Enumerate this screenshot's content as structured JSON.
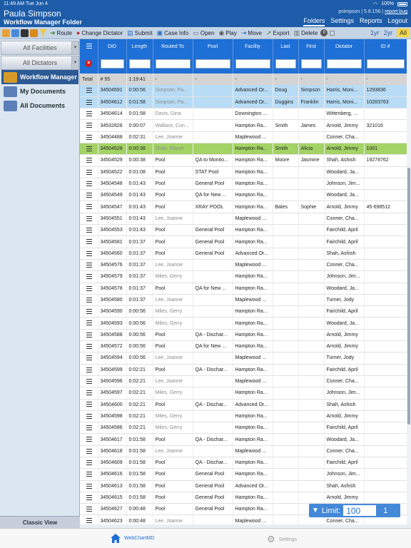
{
  "status": {
    "time": "11:49 AM",
    "date": "Tue Jun 4",
    "battery": "100%"
  },
  "header": {
    "user": "Paula Simpson",
    "folder": "Workflow Manager Folder",
    "account": "psimpson | 5.8.156 |",
    "report_bug": "report bug",
    "nav": [
      "Folders",
      "Settings",
      "Reports",
      "Logout"
    ]
  },
  "toolbar": {
    "route": "Route",
    "change_dictator": "Change Dictator",
    "submit": "Submit",
    "case_info": "Case Info",
    "open": "Open",
    "play": "Play",
    "move": "Move",
    "export": "Export",
    "delete": "Delete",
    "delete_count": "0",
    "range": [
      "1yr",
      "2yr",
      "All"
    ]
  },
  "sidebar": {
    "facilities": "All Facilities",
    "dictators": "All Dictators",
    "items": [
      "Workflow Manager",
      "My Documents",
      "All Documents"
    ],
    "classic": "Classic View"
  },
  "table": {
    "columns": [
      "DID",
      "Length",
      "Routed To",
      "Pool",
      "Facility",
      "Last",
      "First",
      "Dictator",
      "ID #"
    ],
    "total": {
      "label": "Total",
      "did": "# 55",
      "length": "1:19:41",
      "dash": "-"
    },
    "rows": [
      [
        "34504591",
        "0:00:56",
        "Simpson, Pa...",
        "",
        "Advanced Or...",
        "Doug",
        "Simpson",
        "Harris, Moni...",
        "1293836"
      ],
      [
        "34504612",
        "0:01:58",
        "Simpson, Pa...",
        "",
        "Advanced Or...",
        "Duggins",
        "Franklin",
        "Harris, Moni...",
        "10283763"
      ],
      [
        "34504614",
        "0:01:58",
        "Davis, Gina",
        "",
        "Downington ...",
        "",
        "",
        "Wittenberg, ...",
        ""
      ],
      [
        "34532828",
        "0:00:07",
        "Wallace, Con...",
        "",
        "Hampton Ra...",
        "Smith",
        "James",
        "Arnold, Jimmy",
        "321016"
      ],
      [
        "34504488",
        "0:02:31",
        "Lee, Joanne",
        "",
        "Maplewood ...",
        "",
        "",
        "Conner, Cha...",
        ""
      ],
      [
        "34504528",
        "0:00:38",
        "Shah, Ritesh",
        "",
        "Hampton Ra...",
        "Smith",
        "Alicia",
        "Arnold, Jimmy",
        "1001"
      ],
      [
        "34504529",
        "0:00:38",
        "Pool",
        "QA to Monito...",
        "Hampton Ra...",
        "Moore",
        "Jasmine",
        "Shah, Ashish",
        "19278762"
      ],
      [
        "34504522",
        "0:01:08",
        "Pool",
        "STAT Pool",
        "Hampton Ra...",
        "",
        "",
        "Woodard, Ja...",
        ""
      ],
      [
        "34504548",
        "0:01:43",
        "Pool",
        "General Pool",
        "Hampton Ra...",
        "",
        "",
        "Johnson, Jim...",
        ""
      ],
      [
        "34504549",
        "0:01:43",
        "Pool",
        "QA for New ...",
        "Hampton Ra...",
        "",
        "",
        "Woodard, Ja...",
        ""
      ],
      [
        "34504547",
        "0:01:43",
        "Pool",
        "XRAY POOL",
        "Hampton Ra...",
        "Bales",
        "Sophie",
        "Arnold, Jimmy",
        "45-698512"
      ],
      [
        "34504551",
        "0:01:43",
        "Lee, Joanne",
        "",
        "Maplewood ...",
        "",
        "",
        "Conner, Cha...",
        ""
      ],
      [
        "34504553",
        "0:01:43",
        "Pool",
        "General Pool",
        "Hampton Ra...",
        "",
        "",
        "Fairchild, April",
        ""
      ],
      [
        "34504581",
        "0:01:37",
        "Pool",
        "General Pool",
        "Hampton Ra...",
        "",
        "",
        "Fairchild, April",
        ""
      ],
      [
        "34504560",
        "0:01:37",
        "Pool",
        "General Pool",
        "Advanced Or...",
        "",
        "",
        "Shah, Ashish",
        ""
      ],
      [
        "34504576",
        "0:01:37",
        "Lee, Joanne",
        "",
        "Maplewood ...",
        "",
        "",
        "Conner, Cha...",
        ""
      ],
      [
        "34504579",
        "0:01:37",
        "Miles, Gerry",
        "",
        "Hampton Ra...",
        "",
        "",
        "Johnson, Jim...",
        ""
      ],
      [
        "34504578",
        "0:01:37",
        "Pool",
        "QA for New ...",
        "Hampton Ra...",
        "",
        "",
        "Woodard, Ja...",
        ""
      ],
      [
        "34504580",
        "0:01:37",
        "Lee, Joanne",
        "",
        "Maplewood ...",
        "",
        "",
        "Turner, Jody",
        ""
      ],
      [
        "34504590",
        "0:00:56",
        "Miles, Gerry",
        "",
        "Hampton Ra...",
        "",
        "",
        "Fairchild, April",
        ""
      ],
      [
        "34504593",
        "0:00:56",
        "Miles, Gerry",
        "",
        "Hampton Ra...",
        "",
        "",
        "Woodard, Ja...",
        ""
      ],
      [
        "34504588",
        "0:00:56",
        "Pool",
        "QA - Dischar...",
        "Hampton Ra...",
        "",
        "",
        "Arnold, Jimmy",
        ""
      ],
      [
        "34504572",
        "0:00:56",
        "Pool",
        "QA for New ...",
        "Hampton Ra...",
        "",
        "",
        "Arnold, Jimmy",
        ""
      ],
      [
        "34504594",
        "0:00:56",
        "Lee, Joanne",
        "",
        "Maplewood ...",
        "",
        "",
        "Turner, Jody",
        ""
      ],
      [
        "34504599",
        "0:02:21",
        "Pool",
        "QA - Dischar...",
        "Hampton Ra...",
        "",
        "",
        "Fairchild, April",
        ""
      ],
      [
        "34504596",
        "0:02:21",
        "Lee, Joanne",
        "",
        "Maplewood ...",
        "",
        "",
        "Conner, Cha...",
        ""
      ],
      [
        "34504597",
        "0:02:21",
        "Miles, Gerry",
        "",
        "Hampton Ra...",
        "",
        "",
        "Johnson, Jim...",
        ""
      ],
      [
        "34504600",
        "0:02:21",
        "Pool",
        "QA - Dischar...",
        "Advanced Or...",
        "",
        "",
        "Shah, Ashish",
        ""
      ],
      [
        "34504598",
        "0:02:21",
        "Miles, Gerry",
        "",
        "Hampton Ra...",
        "",
        "",
        "Arnold, Jimmy",
        ""
      ],
      [
        "34504586",
        "0:02:21",
        "Miles, Gerry",
        "",
        "Hampton Ra...",
        "",
        "",
        "Fairchild, April",
        ""
      ],
      [
        "34504617",
        "0:01:58",
        "Pool",
        "QA - Dischar...",
        "Hampton Ra...",
        "",
        "",
        "Woodard, Ja...",
        ""
      ],
      [
        "34504618",
        "0:01:58",
        "Lee, Joanne",
        "",
        "Maplewood ...",
        "",
        "",
        "Conner, Cha...",
        ""
      ],
      [
        "34504609",
        "0:01:58",
        "Pool",
        "QA - Dischar...",
        "Hampton Ra...",
        "",
        "",
        "Fairchild, April",
        ""
      ],
      [
        "34504616",
        "0:01:58",
        "Pool",
        "General Pool",
        "Hampton Ra...",
        "",
        "",
        "Johnson, Jim...",
        ""
      ],
      [
        "34504613",
        "0:01:58",
        "Pool",
        "General Pool",
        "Advanced Or...",
        "",
        "",
        "Shah, Ashish",
        ""
      ],
      [
        "34504615",
        "0:01:58",
        "Pool",
        "General Pool",
        "Hampton Ra...",
        "",
        "",
        "Arnold, Jimmy",
        ""
      ],
      [
        "34504627",
        "0:00:48",
        "Pool",
        "General Pool",
        "Hampton Ra...",
        "",
        "",
        "Woodard, Ja...",
        ""
      ],
      [
        "34504623",
        "0:00:48",
        "Lee, Joanne",
        "",
        "Maplewood ...",
        "",
        "",
        "Conner, Cha...",
        ""
      ]
    ]
  },
  "limit": {
    "label": "Limit:",
    "value": "100",
    "page": "1"
  },
  "tabbar": {
    "webchart": "WebChartMD",
    "settings": "Settings"
  }
}
